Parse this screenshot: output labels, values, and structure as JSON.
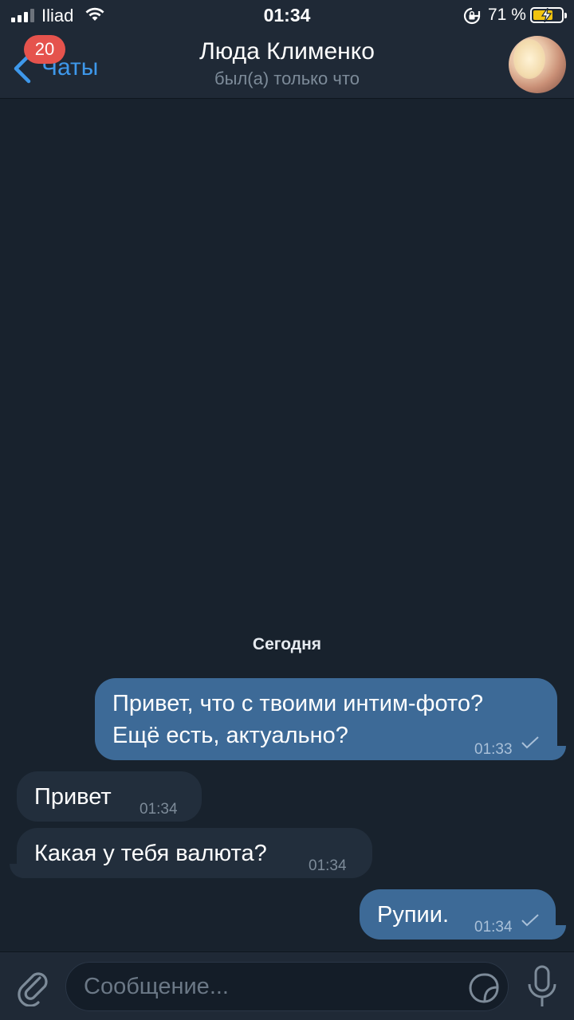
{
  "status_bar": {
    "carrier": "Iliad",
    "time": "01:34",
    "battery_percent": "71 %",
    "icons": [
      "signal-icon",
      "wifi-icon",
      "rotation-lock-icon",
      "battery-charging-icon"
    ]
  },
  "header": {
    "back_label": "Чаты",
    "unread_badge": "20",
    "title": "Люда Клименко",
    "subtitle": "был(а) только что"
  },
  "chat": {
    "date_separator": "Сегодня",
    "messages": [
      {
        "direction": "outgoing",
        "lines": [
          "Привет, что с твоими интим-фото?",
          "Ещё есть, актуально?"
        ],
        "time": "01:33",
        "status": "sent"
      },
      {
        "direction": "incoming",
        "text": "Привет",
        "time": "01:34"
      },
      {
        "direction": "incoming",
        "text": "Какая у тебя валюта?",
        "time": "01:34"
      },
      {
        "direction": "outgoing",
        "text": "Рупии.",
        "time": "01:34",
        "status": "sent"
      }
    ]
  },
  "input_bar": {
    "placeholder": "Сообщение..."
  },
  "colors": {
    "background": "#18222d",
    "bar": "#1f2936",
    "accent": "#3e98eb",
    "outgoing_bubble": "#3d6a97",
    "incoming_bubble": "#222e3c",
    "badge": "#e5534d"
  }
}
